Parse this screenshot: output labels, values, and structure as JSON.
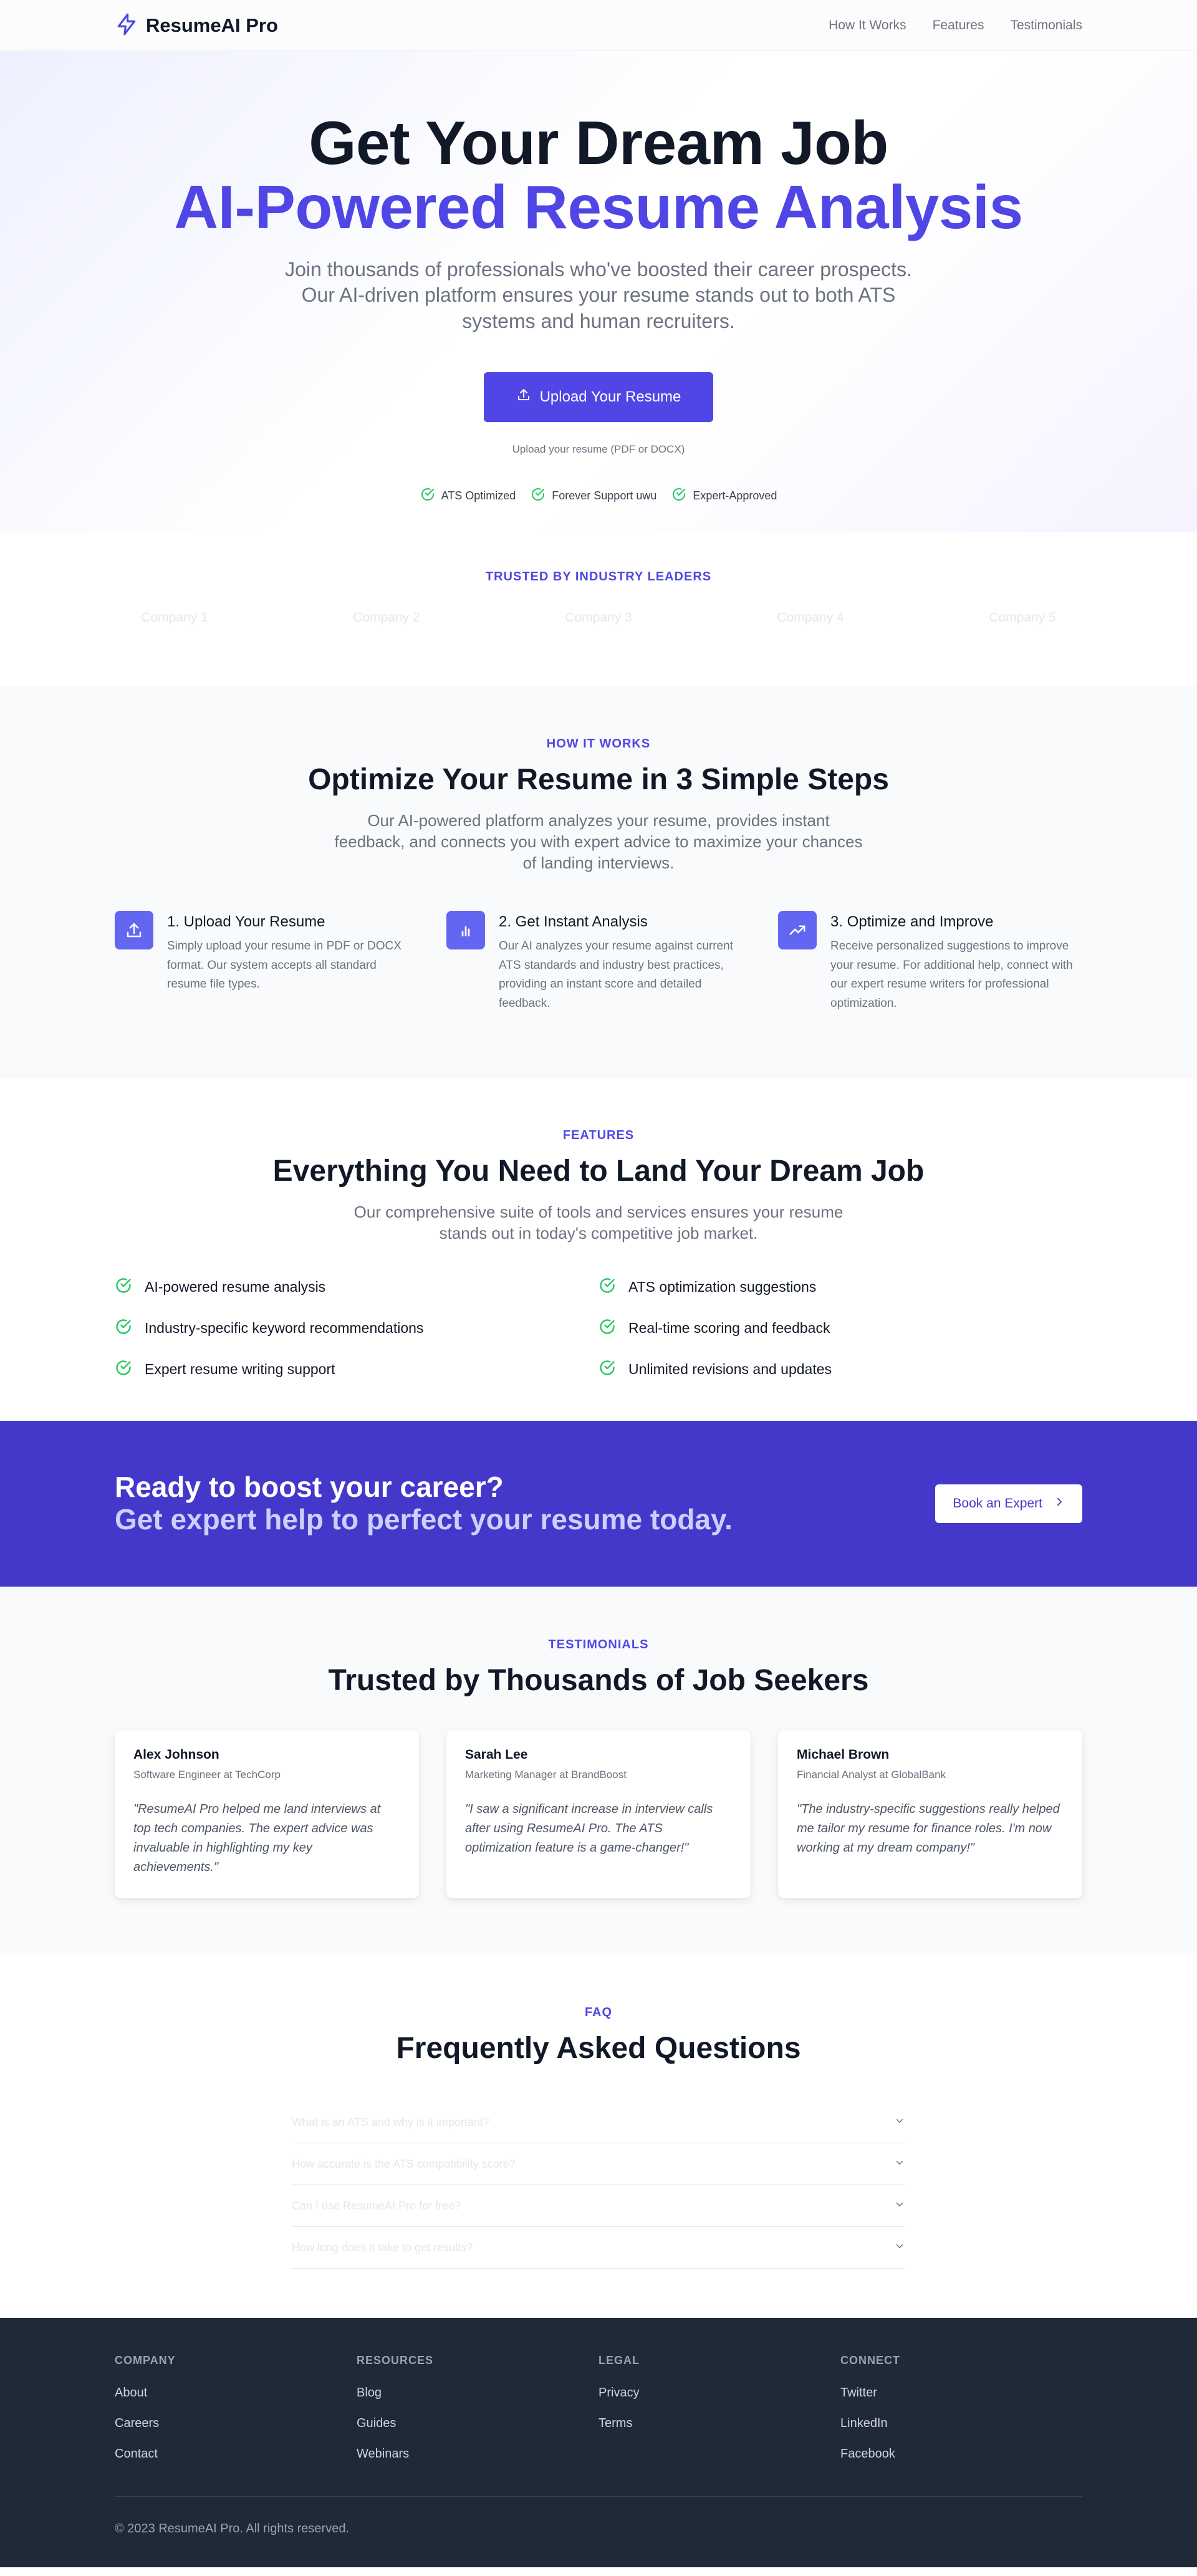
{
  "nav": {
    "brand": "ResumeAI Pro",
    "links": [
      "How It Works",
      "Features",
      "Testimonials"
    ]
  },
  "hero": {
    "title_line1": "Get Your Dream Job",
    "title_line2": "AI-Powered Resume Analysis",
    "subtitle": "Join thousands of professionals who've boosted their career prospects. Our AI-driven platform ensures your resume stands out to both ATS systems and human recruiters.",
    "upload_label": "Upload Your Resume",
    "upload_hint": "Upload your resume (PDF or DOCX)",
    "badges": [
      "ATS Optimized",
      "Forever Support uwu",
      "Expert-Approved"
    ]
  },
  "trusted": {
    "eyebrow": "TRUSTED BY INDUSTRY LEADERS",
    "companies": [
      "Company 1",
      "Company 2",
      "Company 3",
      "Company 4",
      "Company 5"
    ]
  },
  "how": {
    "eyebrow": "HOW IT WORKS",
    "title": "Optimize Your Resume in 3 Simple Steps",
    "subtitle": "Our AI-powered platform analyzes your resume, provides instant feedback, and connects you with expert advice to maximize your chances of landing interviews.",
    "steps": [
      {
        "icon": "upload-icon",
        "title": "1. Upload Your Resume",
        "desc": "Simply upload your resume in PDF or DOCX format. Our system accepts all standard resume file types."
      },
      {
        "icon": "bar-chart-icon",
        "title": "2. Get Instant Analysis",
        "desc": "Our AI analyzes your resume against current ATS standards and industry best practices, providing an instant score and detailed feedback."
      },
      {
        "icon": "trending-up-icon",
        "title": "3. Optimize and Improve",
        "desc": "Receive personalized suggestions to improve your resume. For additional help, connect with our expert resume writers for professional optimization."
      }
    ]
  },
  "features": {
    "eyebrow": "FEATURES",
    "title": "Everything You Need to Land Your Dream Job",
    "subtitle": "Our comprehensive suite of tools and services ensures your resume stands out in today's competitive job market.",
    "items": [
      "AI-powered resume analysis",
      "ATS optimization suggestions",
      "Industry-specific keyword recommendations",
      "Real-time scoring and feedback",
      "Expert resume writing support",
      "Unlimited revisions and updates"
    ]
  },
  "cta": {
    "line1": "Ready to boost your career?",
    "line2": "Get expert help to perfect your resume today.",
    "button": "Book an Expert"
  },
  "testimonials": {
    "eyebrow": "TESTIMONIALS",
    "title": "Trusted by Thousands of Job Seekers",
    "items": [
      {
        "name": "Alex Johnson",
        "role": "Software Engineer at TechCorp",
        "quote": "\"ResumeAI Pro helped me land interviews at top tech companies. The expert advice was invaluable in highlighting my key achievements.\""
      },
      {
        "name": "Sarah Lee",
        "role": "Marketing Manager at BrandBoost",
        "quote": "\"I saw a significant increase in interview calls after using ResumeAI Pro. The ATS optimization feature is a game-changer!\""
      },
      {
        "name": "Michael Brown",
        "role": "Financial Analyst at GlobalBank",
        "quote": "\"The industry-specific suggestions really helped me tailor my resume for finance roles. I'm now working at my dream company!\""
      }
    ]
  },
  "faq": {
    "eyebrow": "FAQ",
    "title": "Frequently Asked Questions",
    "questions": [
      "What is an ATS and why is it important?",
      "How accurate is the ATS compatibility score?",
      "Can I use ResumeAI Pro for free?",
      "How long does it take to get results?"
    ]
  },
  "footer": {
    "columns": [
      {
        "heading": "COMPANY",
        "links": [
          "About",
          "Careers",
          "Contact"
        ]
      },
      {
        "heading": "RESOURCES",
        "links": [
          "Blog",
          "Guides",
          "Webinars"
        ]
      },
      {
        "heading": "LEGAL",
        "links": [
          "Privacy",
          "Terms"
        ]
      },
      {
        "heading": "CONNECT",
        "links": [
          "Twitter",
          "LinkedIn",
          "Facebook"
        ]
      }
    ],
    "copyright": "© 2023 ResumeAI Pro. All rights reserved."
  },
  "colors": {
    "accent": "#4f46e5",
    "cta_bg": "#4338ca",
    "check_green": "#22c55e",
    "footer_bg": "#1f2937"
  }
}
